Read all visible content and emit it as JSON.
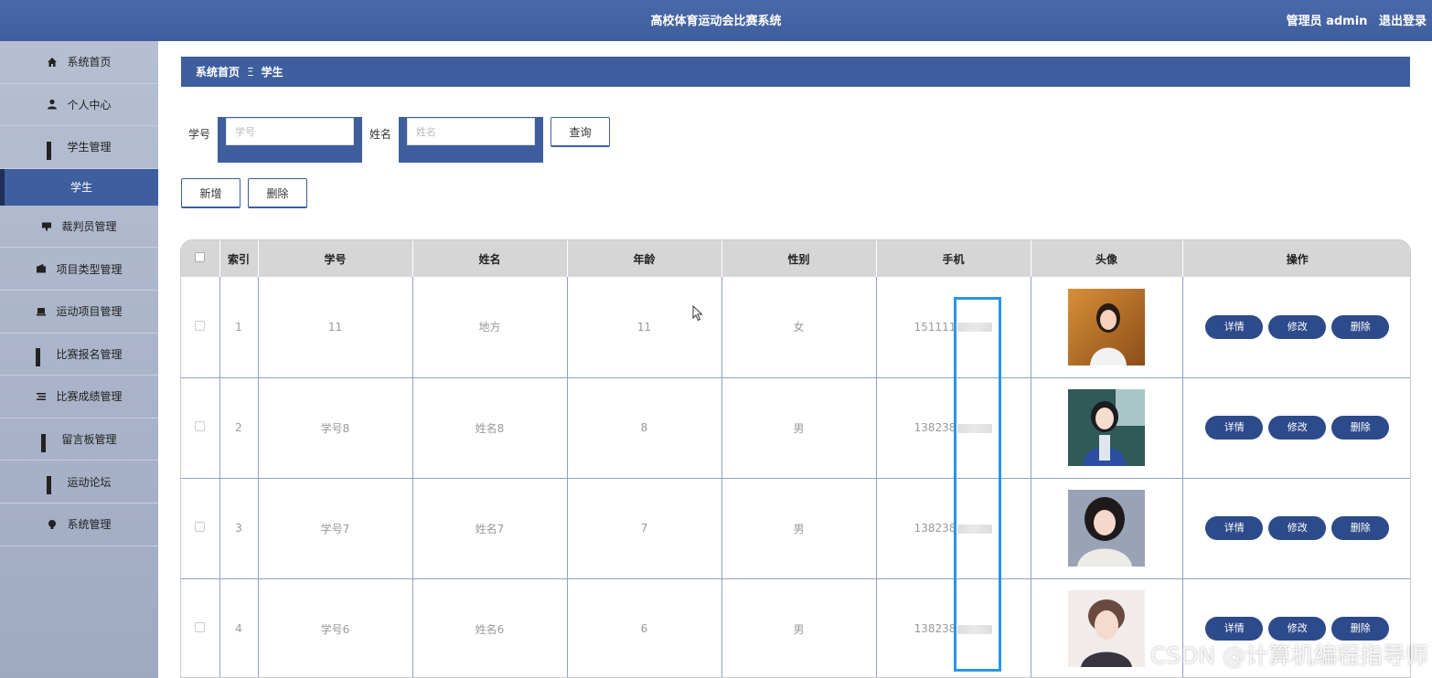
{
  "header": {
    "title": "高校体育运动会比赛系统",
    "user": "管理员 admin",
    "logout": "退出登录"
  },
  "sidebar": {
    "items": [
      {
        "label": "系统首页",
        "icon": "home-icon"
      },
      {
        "label": "个人中心",
        "icon": "user-icon"
      },
      {
        "label": "学生管理",
        "icon": "grid-icon"
      },
      {
        "label": "学生",
        "icon": "",
        "sub": true
      },
      {
        "label": "裁判员管理",
        "icon": "monitor-icon"
      },
      {
        "label": "项目类型管理",
        "icon": "wallet-icon"
      },
      {
        "label": "运动项目管理",
        "icon": "laptop-icon"
      },
      {
        "label": "比赛报名管理",
        "icon": "grid-icon"
      },
      {
        "label": "比赛成绩管理",
        "icon": "list-icon"
      },
      {
        "label": "留言板管理",
        "icon": "grid-icon"
      },
      {
        "label": "运动论坛",
        "icon": "grid-icon"
      },
      {
        "label": "系统管理",
        "icon": "bulb-icon"
      }
    ]
  },
  "breadcrumb": {
    "home": "系统首页",
    "sep": "Ξ",
    "current": "学生"
  },
  "search": {
    "student_no_label": "学号",
    "student_no_placeholder": "学号",
    "name_label": "姓名",
    "name_placeholder": "姓名",
    "query_button": "查询"
  },
  "actions": {
    "add": "新增",
    "delete": "删除"
  },
  "table": {
    "headers": [
      "索引",
      "学号",
      "姓名",
      "年龄",
      "性别",
      "手机",
      "头像",
      "操作"
    ],
    "row_buttons": {
      "detail": "详情",
      "edit": "修改",
      "delete": "删除"
    },
    "rows": [
      {
        "index": "1",
        "student_no": "11",
        "name": "地方",
        "age": "11",
        "gender": "女",
        "phone": "151111"
      },
      {
        "index": "2",
        "student_no": "学号8",
        "name": "姓名8",
        "age": "8",
        "gender": "男",
        "phone": "138238"
      },
      {
        "index": "3",
        "student_no": "学号7",
        "name": "姓名7",
        "age": "7",
        "gender": "男",
        "phone": "138238"
      },
      {
        "index": "4",
        "student_no": "学号6",
        "name": "姓名6",
        "age": "6",
        "gender": "男",
        "phone": "138238"
      }
    ]
  },
  "watermark": "CSDN @计算机编程指导师",
  "colors": {
    "primary": "#3f5e9e",
    "highlight": "#2a95e8",
    "button": "#2d4a8a"
  }
}
